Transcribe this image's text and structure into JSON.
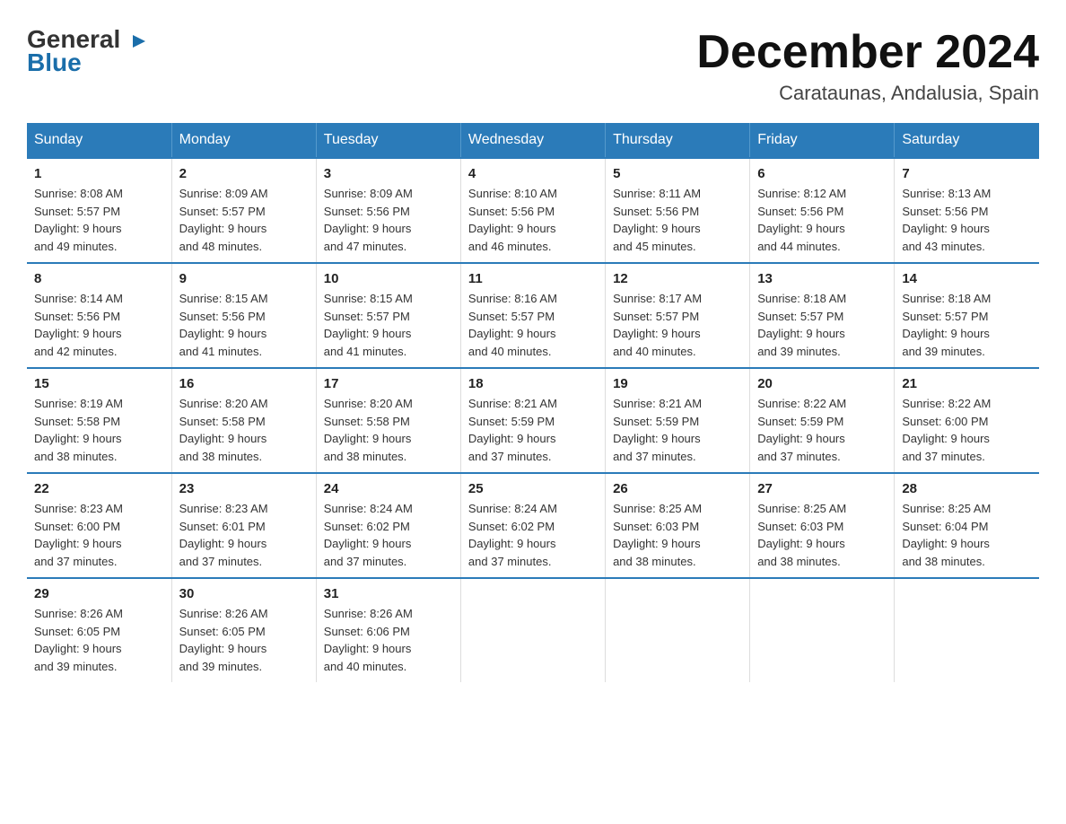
{
  "logo": {
    "general": "General",
    "blue": "Blue",
    "arrow_char": "▶"
  },
  "title": "December 2024",
  "subtitle": "Carataunas, Andalusia, Spain",
  "days_header": [
    "Sunday",
    "Monday",
    "Tuesday",
    "Wednesday",
    "Thursday",
    "Friday",
    "Saturday"
  ],
  "weeks": [
    [
      {
        "day": "1",
        "info": "Sunrise: 8:08 AM\nSunset: 5:57 PM\nDaylight: 9 hours\nand 49 minutes."
      },
      {
        "day": "2",
        "info": "Sunrise: 8:09 AM\nSunset: 5:57 PM\nDaylight: 9 hours\nand 48 minutes."
      },
      {
        "day": "3",
        "info": "Sunrise: 8:09 AM\nSunset: 5:56 PM\nDaylight: 9 hours\nand 47 minutes."
      },
      {
        "day": "4",
        "info": "Sunrise: 8:10 AM\nSunset: 5:56 PM\nDaylight: 9 hours\nand 46 minutes."
      },
      {
        "day": "5",
        "info": "Sunrise: 8:11 AM\nSunset: 5:56 PM\nDaylight: 9 hours\nand 45 minutes."
      },
      {
        "day": "6",
        "info": "Sunrise: 8:12 AM\nSunset: 5:56 PM\nDaylight: 9 hours\nand 44 minutes."
      },
      {
        "day": "7",
        "info": "Sunrise: 8:13 AM\nSunset: 5:56 PM\nDaylight: 9 hours\nand 43 minutes."
      }
    ],
    [
      {
        "day": "8",
        "info": "Sunrise: 8:14 AM\nSunset: 5:56 PM\nDaylight: 9 hours\nand 42 minutes."
      },
      {
        "day": "9",
        "info": "Sunrise: 8:15 AM\nSunset: 5:56 PM\nDaylight: 9 hours\nand 41 minutes."
      },
      {
        "day": "10",
        "info": "Sunrise: 8:15 AM\nSunset: 5:57 PM\nDaylight: 9 hours\nand 41 minutes."
      },
      {
        "day": "11",
        "info": "Sunrise: 8:16 AM\nSunset: 5:57 PM\nDaylight: 9 hours\nand 40 minutes."
      },
      {
        "day": "12",
        "info": "Sunrise: 8:17 AM\nSunset: 5:57 PM\nDaylight: 9 hours\nand 40 minutes."
      },
      {
        "day": "13",
        "info": "Sunrise: 8:18 AM\nSunset: 5:57 PM\nDaylight: 9 hours\nand 39 minutes."
      },
      {
        "day": "14",
        "info": "Sunrise: 8:18 AM\nSunset: 5:57 PM\nDaylight: 9 hours\nand 39 minutes."
      }
    ],
    [
      {
        "day": "15",
        "info": "Sunrise: 8:19 AM\nSunset: 5:58 PM\nDaylight: 9 hours\nand 38 minutes."
      },
      {
        "day": "16",
        "info": "Sunrise: 8:20 AM\nSunset: 5:58 PM\nDaylight: 9 hours\nand 38 minutes."
      },
      {
        "day": "17",
        "info": "Sunrise: 8:20 AM\nSunset: 5:58 PM\nDaylight: 9 hours\nand 38 minutes."
      },
      {
        "day": "18",
        "info": "Sunrise: 8:21 AM\nSunset: 5:59 PM\nDaylight: 9 hours\nand 37 minutes."
      },
      {
        "day": "19",
        "info": "Sunrise: 8:21 AM\nSunset: 5:59 PM\nDaylight: 9 hours\nand 37 minutes."
      },
      {
        "day": "20",
        "info": "Sunrise: 8:22 AM\nSunset: 5:59 PM\nDaylight: 9 hours\nand 37 minutes."
      },
      {
        "day": "21",
        "info": "Sunrise: 8:22 AM\nSunset: 6:00 PM\nDaylight: 9 hours\nand 37 minutes."
      }
    ],
    [
      {
        "day": "22",
        "info": "Sunrise: 8:23 AM\nSunset: 6:00 PM\nDaylight: 9 hours\nand 37 minutes."
      },
      {
        "day": "23",
        "info": "Sunrise: 8:23 AM\nSunset: 6:01 PM\nDaylight: 9 hours\nand 37 minutes."
      },
      {
        "day": "24",
        "info": "Sunrise: 8:24 AM\nSunset: 6:02 PM\nDaylight: 9 hours\nand 37 minutes."
      },
      {
        "day": "25",
        "info": "Sunrise: 8:24 AM\nSunset: 6:02 PM\nDaylight: 9 hours\nand 37 minutes."
      },
      {
        "day": "26",
        "info": "Sunrise: 8:25 AM\nSunset: 6:03 PM\nDaylight: 9 hours\nand 38 minutes."
      },
      {
        "day": "27",
        "info": "Sunrise: 8:25 AM\nSunset: 6:03 PM\nDaylight: 9 hours\nand 38 minutes."
      },
      {
        "day": "28",
        "info": "Sunrise: 8:25 AM\nSunset: 6:04 PM\nDaylight: 9 hours\nand 38 minutes."
      }
    ],
    [
      {
        "day": "29",
        "info": "Sunrise: 8:26 AM\nSunset: 6:05 PM\nDaylight: 9 hours\nand 39 minutes."
      },
      {
        "day": "30",
        "info": "Sunrise: 8:26 AM\nSunset: 6:05 PM\nDaylight: 9 hours\nand 39 minutes."
      },
      {
        "day": "31",
        "info": "Sunrise: 8:26 AM\nSunset: 6:06 PM\nDaylight: 9 hours\nand 40 minutes."
      },
      null,
      null,
      null,
      null
    ]
  ]
}
